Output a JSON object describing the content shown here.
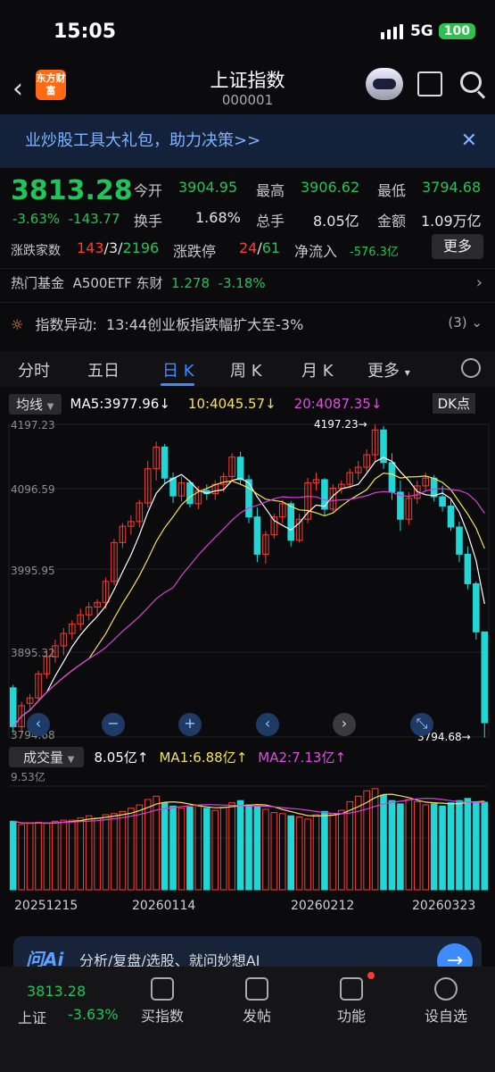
{
  "status": {
    "time": "15:05",
    "network": "5G",
    "battery": "100"
  },
  "header": {
    "logo_text": "东方财富",
    "title": "上证指数",
    "code": "000001"
  },
  "banner": {
    "text": "业炒股工具大礼包，助力决策>>",
    "close": "✕"
  },
  "quote": {
    "price": "3813.28",
    "change_pct": "-3.63%",
    "change": "-143.77",
    "open_label": "今开",
    "open": "3904.95",
    "high_label": "最高",
    "high": "3906.62",
    "low_label": "最低",
    "low": "3794.68",
    "turnover_label": "换手",
    "turnover": "1.68%",
    "volume_label": "总手",
    "volume": "8.05亿",
    "amount_label": "金额",
    "amount": "1.09万亿",
    "breadth_label": "涨跌家数",
    "breadth_up": "143",
    "breadth_flat": "3",
    "breadth_down": "2196",
    "limit_label": "涨跌停",
    "limit_up": "24",
    "limit_down": "61",
    "inflow_label": "净流入",
    "inflow": "-576.3亿",
    "more": "更多"
  },
  "fund": {
    "label": "热门基金",
    "name": "A500ETF 东财",
    "price": "1.278",
    "pct": "-3.18%"
  },
  "alert": {
    "label": "指数异动:",
    "text": "13:44创业板指跌幅扩大至-3%",
    "count": "(3)"
  },
  "tabs": [
    "分时",
    "五日",
    "日 K",
    "周 K",
    "月 K",
    "更多"
  ],
  "active_tab": "日 K",
  "ma_legend": {
    "selector": "均线",
    "ma5": "MA5:3977.96",
    "ma10": "10:4045.57",
    "ma20": "20:4087.35",
    "dk": "DK点"
  },
  "kchart": {
    "y_ticks": [
      "4197.23",
      "4096.59",
      "3995.95",
      "3895.32",
      "3794.68"
    ],
    "y_range": [
      3794.68,
      4197.23
    ],
    "max_label": "4197.23→",
    "min_label": "3794.68→",
    "colors": {
      "up": "#ff3b30",
      "down": "#23d6d6",
      "ma5": "#ffffff",
      "ma10": "#f5e15a",
      "ma20": "#d93fd9"
    }
  },
  "volume": {
    "selector": "成交量",
    "value": "8.05亿",
    "ma1": "MA1:6.88亿",
    "ma2": "MA2:7.13亿",
    "max_tick": "9.53亿"
  },
  "x_dates": [
    "20251215",
    "20260114",
    "20260212",
    "20260323"
  ],
  "ai": {
    "logo": "问Ai",
    "text": "分析/复盘/选股、就问妙想AI"
  },
  "bottom_nav": {
    "price": "3813.28",
    "name": "上证",
    "pct": "-3.63%",
    "items": [
      "买指数",
      "发帖",
      "功能",
      "设自选"
    ]
  },
  "chart_data": {
    "type": "candlestick",
    "ylim": [
      3794.68,
      4197.23
    ],
    "candles": [
      [
        3858,
        3862,
        3800,
        3808
      ],
      [
        3808,
        3840,
        3800,
        3835
      ],
      [
        3838,
        3850,
        3830,
        3845
      ],
      [
        3845,
        3880,
        3840,
        3876
      ],
      [
        3876,
        3905,
        3870,
        3898
      ],
      [
        3898,
        3920,
        3890,
        3912
      ],
      [
        3912,
        3935,
        3900,
        3928
      ],
      [
        3928,
        3945,
        3920,
        3940
      ],
      [
        3940,
        3960,
        3932,
        3952
      ],
      [
        3952,
        3968,
        3945,
        3962
      ],
      [
        3962,
        3972,
        3950,
        3968
      ],
      [
        3968,
        4000,
        3960,
        3995
      ],
      [
        3995,
        4050,
        3990,
        4045
      ],
      [
        4045,
        4070,
        4038,
        4066
      ],
      [
        4066,
        4080,
        4055,
        4072
      ],
      [
        4072,
        4100,
        4065,
        4096
      ],
      [
        4096,
        4150,
        4090,
        4140
      ],
      [
        4140,
        4175,
        4125,
        4168
      ],
      [
        4168,
        4172,
        4120,
        4128
      ],
      [
        4128,
        4135,
        4096,
        4105
      ],
      [
        4105,
        4130,
        4098,
        4122
      ],
      [
        4122,
        4125,
        4090,
        4095
      ],
      [
        4095,
        4118,
        4088,
        4112
      ],
      [
        4112,
        4120,
        4100,
        4108
      ],
      [
        4108,
        4125,
        4100,
        4120
      ],
      [
        4120,
        4135,
        4110,
        4130
      ],
      [
        4130,
        4160,
        4125,
        4155
      ],
      [
        4155,
        4162,
        4120,
        4126
      ],
      [
        4126,
        4132,
        4070,
        4078
      ],
      [
        4078,
        4090,
        4020,
        4030
      ],
      [
        4030,
        4060,
        4018,
        4055
      ],
      [
        4055,
        4082,
        4050,
        4078
      ],
      [
        4078,
        4100,
        4070,
        4095
      ],
      [
        4095,
        4098,
        4040,
        4048
      ],
      [
        4048,
        4082,
        4045,
        4075
      ],
      [
        4075,
        4128,
        4070,
        4122
      ],
      [
        4122,
        4135,
        4112,
        4126
      ],
      [
        4126,
        4128,
        4080,
        4088
      ],
      [
        4088,
        4120,
        4085,
        4115
      ],
      [
        4115,
        4125,
        4108,
        4120
      ],
      [
        4120,
        4140,
        4115,
        4135
      ],
      [
        4135,
        4150,
        4126,
        4142
      ],
      [
        4142,
        4165,
        4136,
        4158
      ],
      [
        4158,
        4197,
        4150,
        4190
      ],
      [
        4190,
        4195,
        4140,
        4148
      ],
      [
        4148,
        4160,
        4100,
        4110
      ],
      [
        4110,
        4125,
        4060,
        4075
      ],
      [
        4075,
        4110,
        4068,
        4102
      ],
      [
        4102,
        4125,
        4095,
        4118
      ],
      [
        4118,
        4135,
        4112,
        4128
      ],
      [
        4128,
        4132,
        4098,
        4104
      ],
      [
        4104,
        4118,
        4085,
        4092
      ],
      [
        4092,
        4100,
        4060,
        4065
      ],
      [
        4065,
        4072,
        4020,
        4030
      ],
      [
        4030,
        4040,
        3985,
        3992
      ],
      [
        3992,
        3995,
        3920,
        3930
      ],
      [
        3930,
        3905,
        3794,
        3813
      ]
    ],
    "volume": [
      6.3,
      6.0,
      6.1,
      6.2,
      6.1,
      6.3,
      6.4,
      6.4,
      6.6,
      6.8,
      6.6,
      6.9,
      7.0,
      7.2,
      7.5,
      7.8,
      8.3,
      8.6,
      8.0,
      7.7,
      7.5,
      7.6,
      7.8,
      7.5,
      7.3,
      7.6,
      8.0,
      8.2,
      7.8,
      7.6,
      7.4,
      7.1,
      7.0,
      6.8,
      6.7,
      6.5,
      6.9,
      7.2,
      7.0,
      7.3,
      8.1,
      8.6,
      9.1,
      9.3,
      8.7,
      8.2,
      7.9,
      8.3,
      8.1,
      7.8,
      7.9,
      7.7,
      8.0,
      8.2,
      8.4,
      8.1,
      8.05
    ]
  }
}
